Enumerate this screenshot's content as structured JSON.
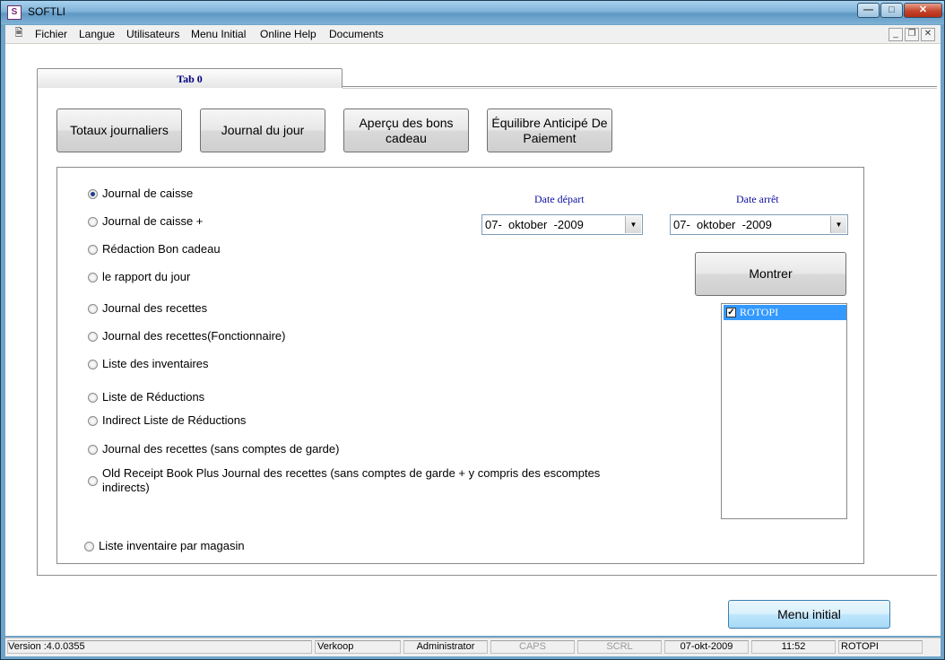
{
  "window": {
    "title": "SOFTLI",
    "icon": "softli-app-icon",
    "controls": {
      "minimize_icon": "minimize-icon",
      "maximize_icon": "maximize-icon",
      "close_icon": "close-icon"
    }
  },
  "menu": {
    "doc_icon": "document-window-icon",
    "items": [
      "Fichier",
      "Langue",
      "Utilisateurs",
      "Menu Initial",
      "Online Help",
      "Documents"
    ]
  },
  "tabs": [
    {
      "label": "Tab 0",
      "selected": true
    }
  ],
  "toolbar_buttons": [
    "Totaux journaliers",
    "Journal du jour",
    "Aperçu des bons cadeau",
    "Équilibre Anticipé De Paiement"
  ],
  "report_options": [
    {
      "label": "Journal de caisse",
      "selected": true
    },
    {
      "label": "Journal de caisse +",
      "selected": false
    },
    {
      "label": "Rédaction Bon cadeau",
      "selected": false
    },
    {
      "label": "le rapport du jour",
      "selected": false
    },
    {
      "label": "Journal des recettes",
      "selected": false
    },
    {
      "label": "Journal des recettes(Fonctionnaire)",
      "selected": false
    },
    {
      "label": "Liste des inventaires",
      "selected": false
    },
    {
      "label": "Liste de Réductions",
      "selected": false
    },
    {
      "label": "Indirect Liste de Réductions",
      "selected": false
    },
    {
      "label": "Journal des recettes (sans comptes de garde)",
      "selected": false
    },
    {
      "label": "Old Receipt Book Plus Journal des recettes (sans comptes de garde + y compris des escomptes indirects)",
      "selected": false
    },
    {
      "label": "Liste inventaire par magasin",
      "selected": false
    }
  ],
  "date_start": {
    "label": "Date départ",
    "value": "07-  oktober  -2009"
  },
  "date_end": {
    "label": "Date arrêt",
    "value": "07-  oktober  -2009"
  },
  "show_button": "Montrer",
  "store_list": [
    {
      "label": "ROTOPI",
      "checked": true,
      "selected": true
    }
  ],
  "main_menu_button": "Menu initial",
  "statusbar": {
    "version": "Version :4.0.0355",
    "mode": "Verkoop",
    "user": "Administrator",
    "caps": "CAPS",
    "scrl": "SCRL",
    "date": "07-okt-2009",
    "time": "11:52",
    "store": "ROTOPI"
  }
}
